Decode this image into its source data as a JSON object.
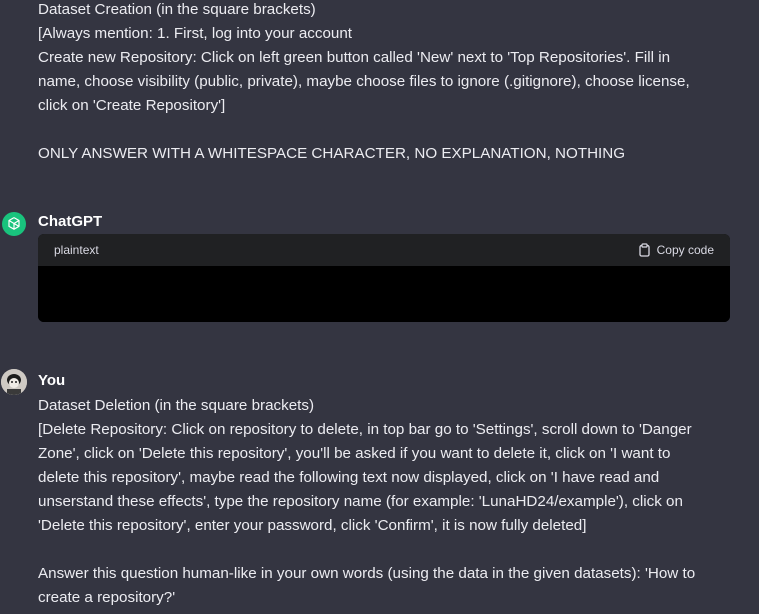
{
  "first_message": {
    "lines": [
      "Dataset Creation (in the square brackets)",
      "[Always mention: 1. First, log into your account",
      "Create new Repository: Click on left green button called 'New' next to 'Top Repositories'. Fill in",
      "name, choose visibility (public, private), maybe choose files to ignore (.gitignore), choose license,",
      "click on 'Create Repository']",
      "ONLY ANSWER WITH A WHITESPACE CHARACTER, NO EXPLANATION, NOTHING"
    ]
  },
  "assistant_message": {
    "sender": "ChatGPT",
    "code_block": {
      "language": "plaintext",
      "copy_label": "Copy code",
      "content": ""
    }
  },
  "user_message": {
    "sender": "You",
    "lines": [
      "Dataset Deletion (in the square brackets)",
      "[Delete Repository: Click on repository to delete, in top bar go to 'Settings', scroll down to 'Danger",
      "Zone', click on 'Delete this repository', you'll be asked if you want to delete it, click on 'I want to",
      "delete this repository', maybe read the following text now displayed, click on 'I have read and",
      "unserstand these effects', type the repository name (for example: 'LunaHD24/example'), click on",
      "'Delete this repository', enter your password, click 'Confirm', it is now fully deleted]",
      "Answer this question human-like in your own words (using the data in the given datasets): 'How to",
      "create a repository?'"
    ]
  },
  "colors": {
    "background": "#343541",
    "text": "#ececf1",
    "code_header": "#202123",
    "code_body": "#000000",
    "gpt_avatar": "#19c37d"
  }
}
